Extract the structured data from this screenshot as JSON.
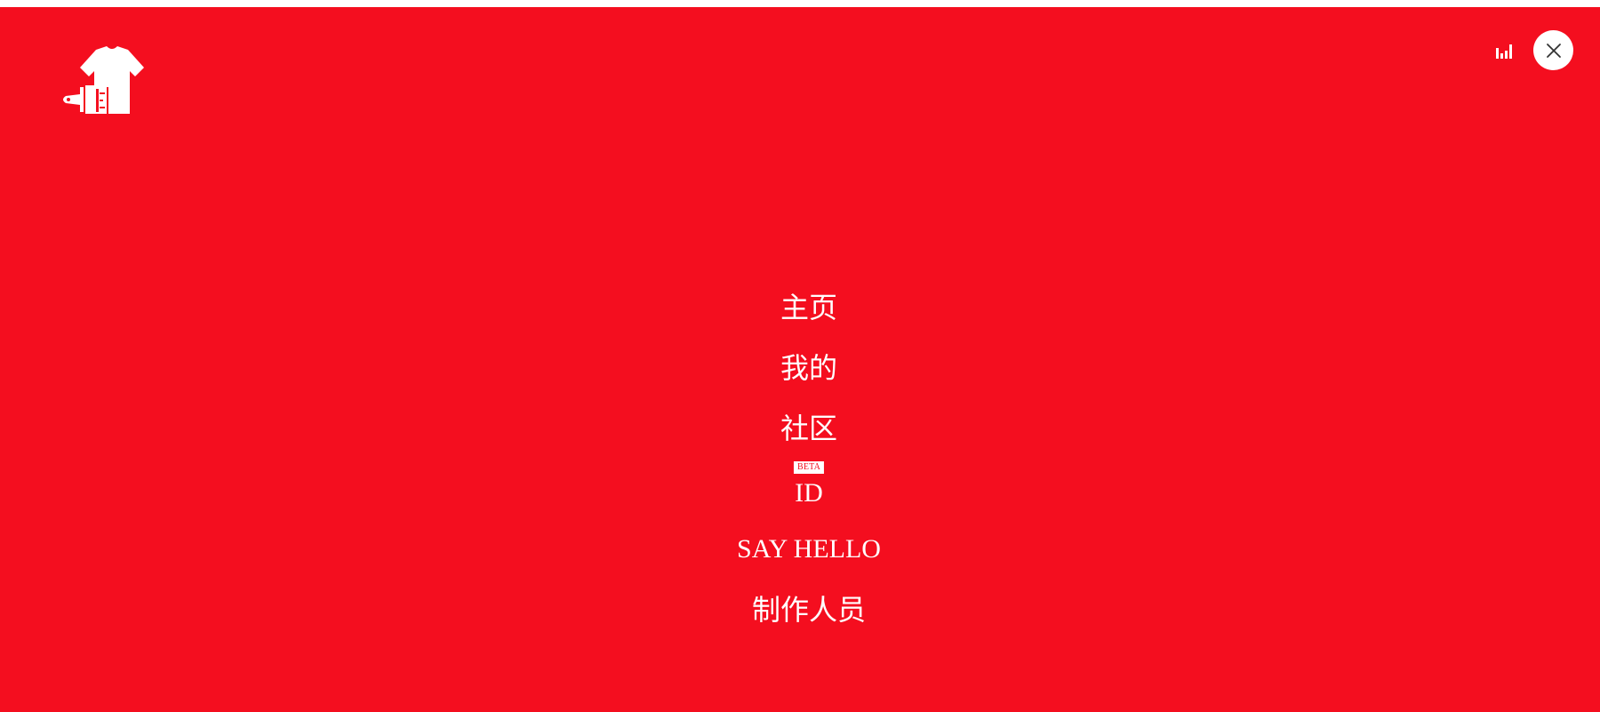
{
  "colors": {
    "background": "#f40e1f",
    "foreground": "#ffffff",
    "close_icon": "#333333"
  },
  "header": {
    "logo_icon": "tshirt-paintbrush-logo-icon",
    "stats_icon": "bar-chart-icon",
    "close_icon": "close-icon"
  },
  "nav": {
    "items": [
      {
        "label": "主页"
      },
      {
        "label": "我的"
      },
      {
        "label": "社区"
      },
      {
        "label": "ID",
        "badge": "BETA"
      },
      {
        "label": "SAY HELLO"
      },
      {
        "label": "制作人员"
      }
    ]
  }
}
